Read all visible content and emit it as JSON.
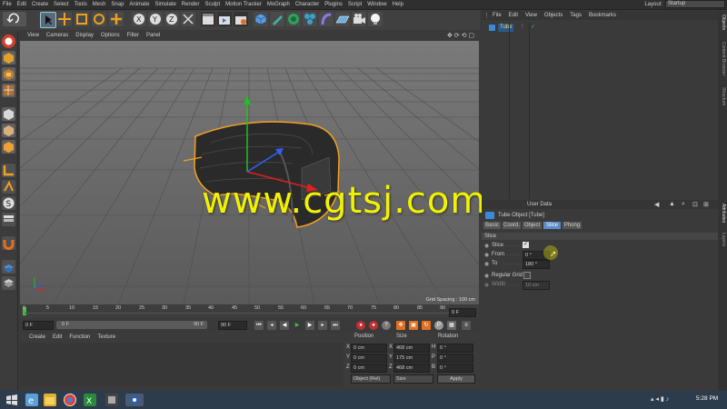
{
  "menubar": {
    "items": [
      "File",
      "Edit",
      "Create",
      "Select",
      "Tools",
      "Mesh",
      "Snap",
      "Animate",
      "Simulate",
      "Render",
      "Sculpt",
      "Motion Tracker",
      "MoGraph",
      "Character",
      "Plugins",
      "Script",
      "Window",
      "Help"
    ],
    "layout_label": "Layout:",
    "layout_value": "Startup"
  },
  "viewport": {
    "menu": [
      "View",
      "Cameras",
      "Display",
      "Options",
      "Filter",
      "Panel"
    ],
    "grid_spacing": "Grid Spacing : 100 cm"
  },
  "watermark": "www.cgtsj.com",
  "timeline": {
    "ticks": [
      "0",
      "5",
      "10",
      "15",
      "20",
      "25",
      "30",
      "35",
      "40",
      "45",
      "50",
      "55",
      "60",
      "65",
      "70",
      "75",
      "80",
      "85",
      "90"
    ],
    "end_frame": "0 F",
    "start_field": "0 F",
    "slider_start": "0 F",
    "slider_end": "90 F",
    "max_field": "90 F"
  },
  "material_menu": [
    "Create",
    "Edit",
    "Function",
    "Texture"
  ],
  "coordinates": {
    "headers": [
      "Position",
      "Size",
      "Rotation"
    ],
    "rows": [
      {
        "axis": "X",
        "pos": "0 cm",
        "size_axis": "X",
        "size": "468 cm",
        "rot_axis": "H",
        "rot": "0 °"
      },
      {
        "axis": "Y",
        "pos": "0 cm",
        "size_axis": "Y",
        "size": "175 cm",
        "rot_axis": "P",
        "rot": "0 °"
      },
      {
        "axis": "Z",
        "pos": "0 cm",
        "size_axis": "Z",
        "size": "468 cm",
        "rot_axis": "B",
        "rot": "0 °"
      }
    ],
    "mode": "Object (Rel)",
    "size_mode": "Size",
    "apply": "Apply"
  },
  "object_manager": {
    "menu": [
      "File",
      "Edit",
      "View",
      "Objects",
      "Tags",
      "Bookmarks"
    ],
    "object_name": "Tube"
  },
  "attribute_manager": {
    "header_label": "User Data",
    "object_label": "Tube Object [Tube]",
    "tabs": [
      "Basic",
      "Coord.",
      "Object",
      "Slice",
      "Phong"
    ],
    "active_tab": "Slice",
    "section": "Slice",
    "fields": [
      {
        "label": "Slice",
        "value": "✓"
      },
      {
        "label": "From",
        "value": "0 °"
      },
      {
        "label": "To",
        "value": "180 °"
      }
    ],
    "regular_grid_label": "Regular Grid",
    "width_label": "Width",
    "width_value": "10 cm"
  },
  "right_tabs": [
    "Objects",
    "Content Browser",
    "Structure",
    "Attributes",
    "Layers"
  ],
  "taskbar": {
    "time": "5:28 PM"
  },
  "colors": {
    "accent_orange": "#f0a020",
    "axis_red": "#e02020",
    "axis_green": "#20c020",
    "axis_blue": "#3060ff",
    "watermark_yellow": "#f2f200",
    "active_tab_blue": "#5a8ac8"
  }
}
